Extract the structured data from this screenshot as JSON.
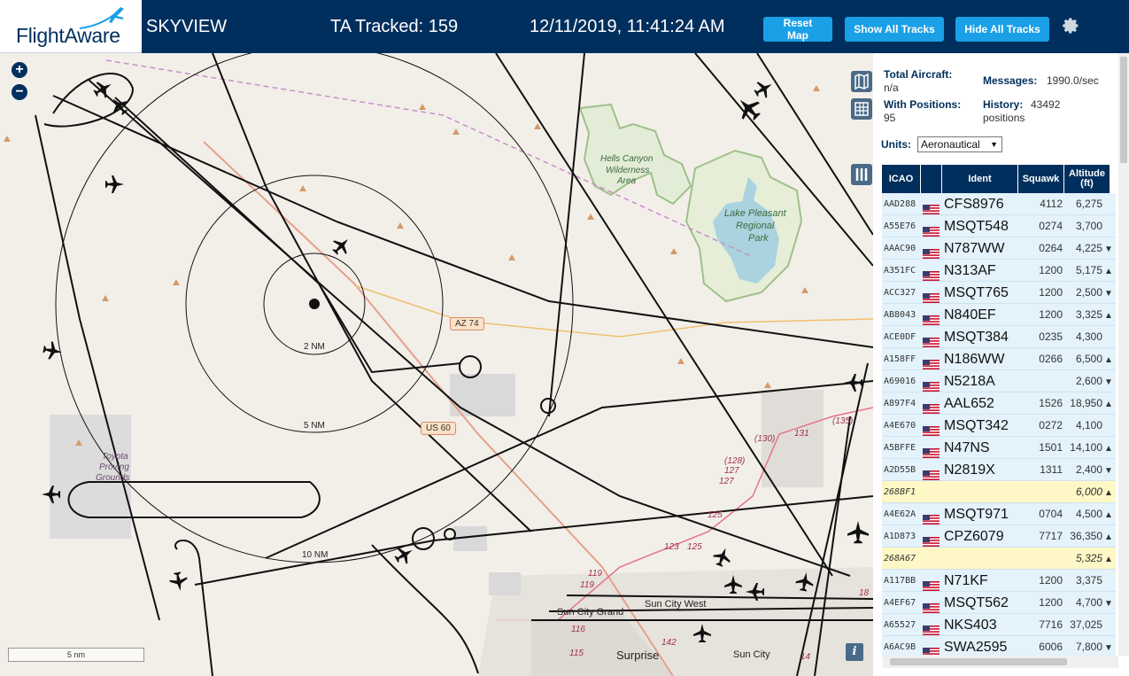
{
  "header": {
    "logo": "FlightAware",
    "app_name": "SKYVIEW",
    "ta_tracked": "TA Tracked: 159",
    "clock": "12/11/2019, 11:41:24 AM",
    "reset_map": "Reset Map",
    "show_all_tracks": "Show All Tracks",
    "hide_all_tracks": "Hide All Tracks"
  },
  "map": {
    "zoom_in": "+",
    "zoom_out": "−",
    "scale": "5 nm",
    "info": "i",
    "range_rings": [
      "2 NM",
      "5 NM",
      "10 NM"
    ],
    "place_labels": {
      "hells_canyon": "Hells Canyon Wilderness Area",
      "hells_canyon_l1": "Hells Canyon",
      "hells_canyon_l2": "Wilderness",
      "hells_canyon_l3": "Area",
      "lake_l1": "Lake Pleasant",
      "lake_l2": "Regional",
      "lake_l3": "Park",
      "toyota_l1": "Toyota",
      "toyota_l2": "Proving",
      "toyota_l3": "Grounds",
      "sun_city_grand": "Sun City Grand",
      "sun_city_west": "Sun City West",
      "surprise": "Surprise",
      "sun_city": "Sun City"
    },
    "road_shields": [
      "AZ 74",
      "US 60"
    ],
    "road_numbers": [
      "131",
      "(135)",
      "(130)",
      "(128)",
      "127",
      "127",
      "125",
      "123",
      "125",
      "119",
      "119",
      "116",
      "115",
      "142",
      "14",
      "18"
    ]
  },
  "sidebar": {
    "total_aircraft_label": "Total Aircraft:",
    "total_aircraft_value": "n/a",
    "with_positions_label": "With Positions:",
    "with_positions_value": "95",
    "messages_label": "Messages:",
    "messages_value": "1990.0/sec",
    "history_label": "History:",
    "history_value": "43492",
    "history_unit": "positions",
    "units_label": "Units:",
    "units_value": "Aeronautical"
  },
  "table": {
    "headers": {
      "icao": "ICAO",
      "ident": "Ident",
      "squawk": "Squawk",
      "alt1": "Altitude",
      "alt2": "(ft)"
    },
    "rows": [
      {
        "icao": "AAD288",
        "flag": true,
        "ident": "CFS8976",
        "squawk": "4112",
        "alt": "6,275",
        "trend": ""
      },
      {
        "icao": "A55E76",
        "flag": true,
        "ident": "MSQT548",
        "squawk": "0274",
        "alt": "3,700",
        "trend": ""
      },
      {
        "icao": "AAAC90",
        "flag": true,
        "ident": "N787WW",
        "squawk": "0264",
        "alt": "4,225",
        "trend": "▼"
      },
      {
        "icao": "A351FC",
        "flag": true,
        "ident": "N313AF",
        "squawk": "1200",
        "alt": "5,175",
        "trend": "▲"
      },
      {
        "icao": "ACC327",
        "flag": true,
        "ident": "MSQT765",
        "squawk": "1200",
        "alt": "2,500",
        "trend": "▼"
      },
      {
        "icao": "AB8043",
        "flag": true,
        "ident": "N840EF",
        "squawk": "1200",
        "alt": "3,325",
        "trend": "▲"
      },
      {
        "icao": "ACE0DF",
        "flag": true,
        "ident": "MSQT384",
        "squawk": "0235",
        "alt": "4,300",
        "trend": ""
      },
      {
        "icao": "A158FF",
        "flag": true,
        "ident": "N186WW",
        "squawk": "0266",
        "alt": "6,500",
        "trend": "▲"
      },
      {
        "icao": "A69016",
        "flag": true,
        "ident": "N5218A",
        "squawk": "",
        "alt": "2,600",
        "trend": "▼"
      },
      {
        "icao": "A897F4",
        "flag": true,
        "ident": "AAL652",
        "squawk": "1526",
        "alt": "18,950",
        "trend": "▲"
      },
      {
        "icao": "A4E670",
        "flag": true,
        "ident": "MSQT342",
        "squawk": "0272",
        "alt": "4,100",
        "trend": ""
      },
      {
        "icao": "A5BFFE",
        "flag": true,
        "ident": "N47NS",
        "squawk": "1501",
        "alt": "14,100",
        "trend": "▲"
      },
      {
        "icao": "A2D55B",
        "flag": true,
        "ident": "N2819X",
        "squawk": "1311",
        "alt": "2,400",
        "trend": "▼"
      },
      {
        "icao": "268BF1",
        "flag": false,
        "ident": "",
        "squawk": "",
        "alt": "6,000",
        "trend": "▲",
        "hl": true
      },
      {
        "icao": "A4E62A",
        "flag": true,
        "ident": "MSQT971",
        "squawk": "0704",
        "alt": "4,500",
        "trend": "▲"
      },
      {
        "icao": "A1D873",
        "flag": true,
        "ident": "CPZ6079",
        "squawk": "7717",
        "alt": "36,350",
        "trend": "▲"
      },
      {
        "icao": "268A67",
        "flag": false,
        "ident": "",
        "squawk": "",
        "alt": "5,325",
        "trend": "▲",
        "hl": true
      },
      {
        "icao": "A117BB",
        "flag": true,
        "ident": "N71KF",
        "squawk": "1200",
        "alt": "3,375",
        "trend": ""
      },
      {
        "icao": "A4EF67",
        "flag": true,
        "ident": "MSQT562",
        "squawk": "1200",
        "alt": "4,700",
        "trend": "▼"
      },
      {
        "icao": "A65527",
        "flag": true,
        "ident": "NKS403",
        "squawk": "7716",
        "alt": "37,025",
        "trend": ""
      },
      {
        "icao": "A6AC9B",
        "flag": true,
        "ident": "SWA2595",
        "squawk": "6006",
        "alt": "7,800",
        "trend": "▼"
      }
    ]
  },
  "colors": {
    "header_bg": "#002f5d",
    "button": "#1aa0e6",
    "row_us": "#e3f2fb",
    "row_highlight": "#fff7c6"
  }
}
